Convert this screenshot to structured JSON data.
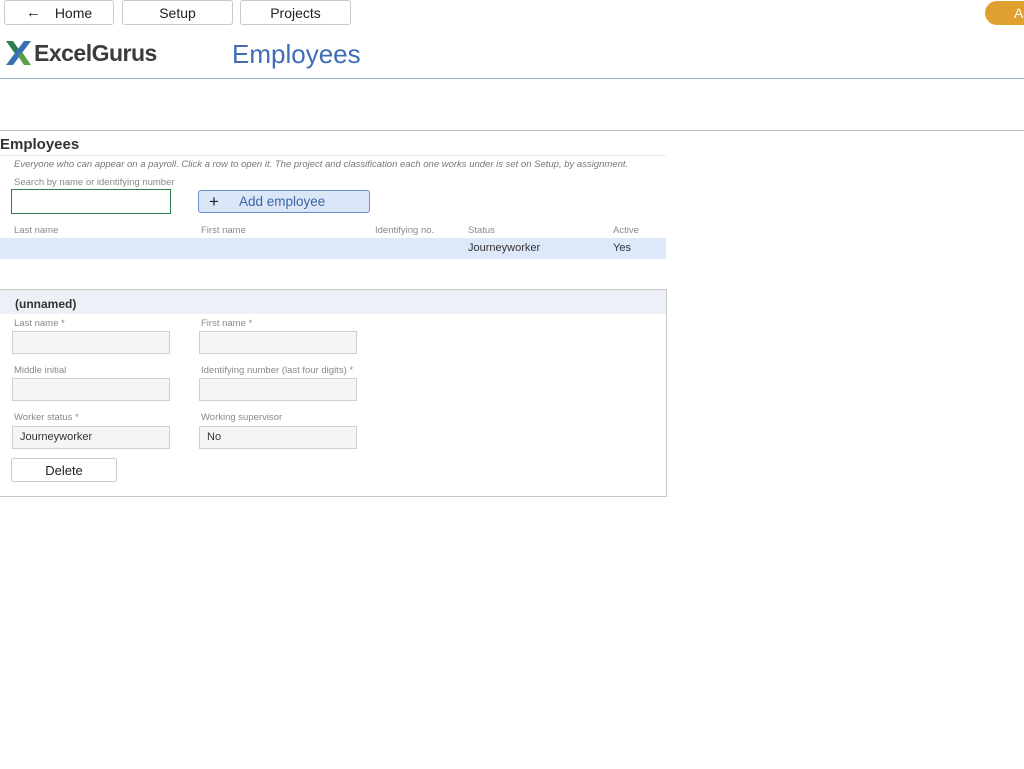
{
  "nav": {
    "home_label": "Home",
    "setup_label": "Setup",
    "projects_label": "Projects",
    "account_label": "A"
  },
  "header": {
    "logo_text": "ExcelGurus",
    "page_title": "Employees"
  },
  "employees": {
    "section_title": "Employees",
    "description": "Everyone who can appear on a payroll. Click a row to open it. The project and classification each one works under is set on Setup, by assignment.",
    "search_label": "Search by name or identifying number",
    "search_value": "",
    "add_button_label": "Add employee",
    "columns": [
      "Last name",
      "First name",
      "Identifying no.",
      "Status",
      "Active"
    ],
    "rows": [
      {
        "last_name": "",
        "first_name": "",
        "identifying_no": "",
        "status": "Journeyworker",
        "active": "Yes"
      }
    ]
  },
  "detail": {
    "title": "(unnamed)",
    "last_name_label": "Last name *",
    "last_name_value": "",
    "first_name_label": "First name *",
    "first_name_value": "",
    "middle_initial_label": "Middle initial",
    "middle_initial_value": "",
    "identifying_number_label": "Identifying number (last four digits) *",
    "identifying_number_value": "",
    "worker_status_label": "Worker status *",
    "worker_status_value": "Journeyworker",
    "working_supervisor_label": "Working supervisor",
    "working_supervisor_value": "No",
    "delete_label": "Delete"
  },
  "colors": {
    "accent_blue": "#3f6cb5",
    "selected_row": "#dde8f9",
    "account_orange": "#e0a030",
    "logo_green": "#2e7d4c"
  }
}
